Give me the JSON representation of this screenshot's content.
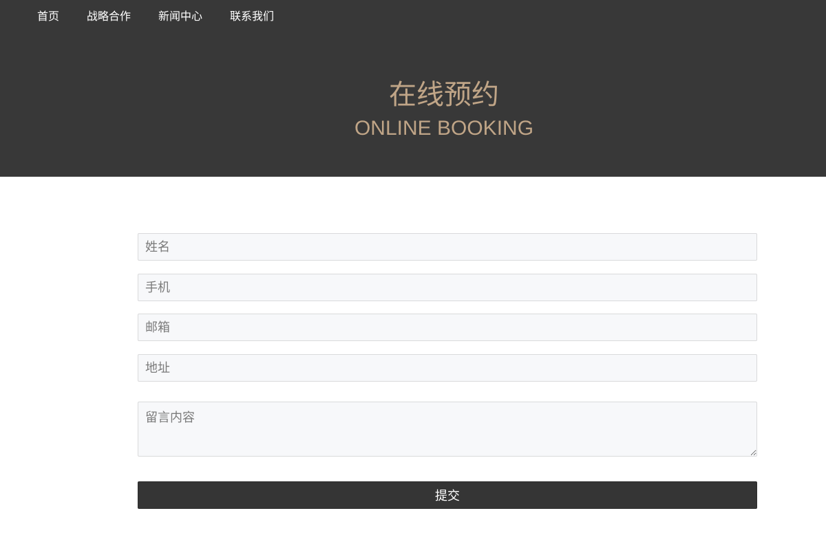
{
  "nav": {
    "items": [
      {
        "label": "首页"
      },
      {
        "label": "战略合作"
      },
      {
        "label": "新闻中心"
      },
      {
        "label": "联系我们"
      }
    ]
  },
  "hero": {
    "title_zh": "在线预约",
    "title_en": "ONLINE BOOKING"
  },
  "form": {
    "name_placeholder": "姓名",
    "phone_placeholder": "手机",
    "email_placeholder": "邮箱",
    "address_placeholder": "地址",
    "message_placeholder": "留言内容",
    "submit_label": "提交"
  },
  "colors": {
    "header_bg": "#383838",
    "accent": "#c0a587",
    "field_bg": "#f7f8fa",
    "button_bg": "#353535"
  }
}
